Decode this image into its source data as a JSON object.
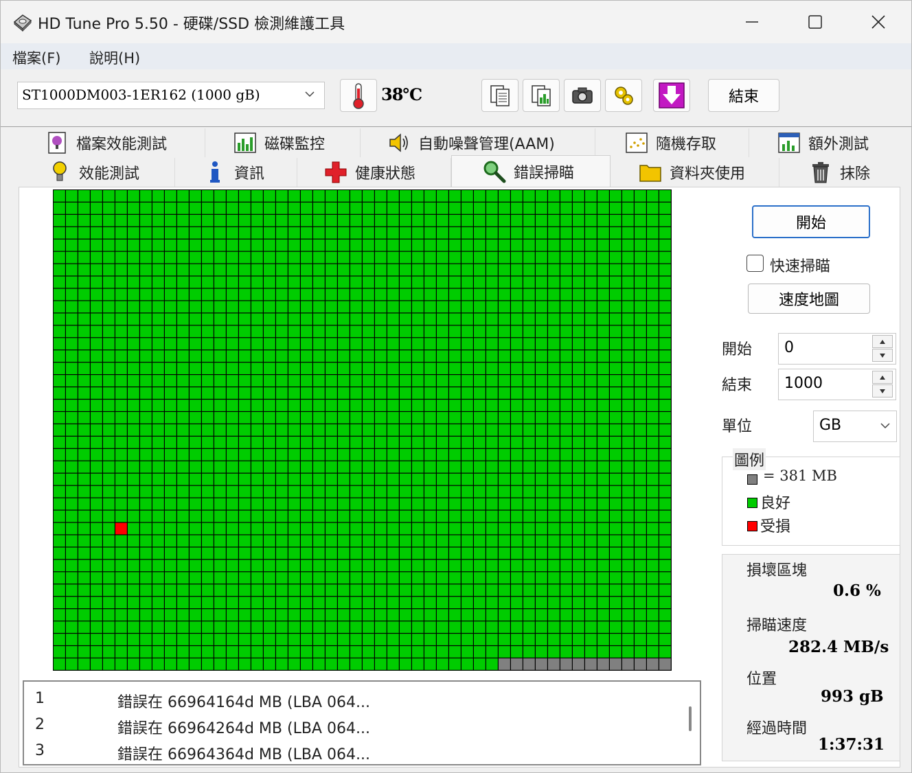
{
  "window": {
    "title": "HD Tune Pro 5.50 - 硬碟/SSD 檢測維護工具"
  },
  "menu": {
    "file": "檔案(F)",
    "help": "說明(H)"
  },
  "toolbar": {
    "drive": "ST1000DM003-1ER162 (1000 gB)",
    "temperature": "38℃",
    "exit_label": "結束",
    "icons": [
      "copy-text-icon",
      "copy-image-icon",
      "screenshot-icon",
      "options-icon",
      "save-icon"
    ]
  },
  "tabs": {
    "row1": [
      "檔案效能測試",
      "磁碟監控",
      "自動噪聲管理(AAM)",
      "隨機存取",
      "額外測試"
    ],
    "row2": [
      "效能測試",
      "資訊",
      "健康狀態",
      "錯誤掃瞄",
      "資料夾使用",
      "抹除"
    ],
    "active": "錯誤掃瞄"
  },
  "controls": {
    "start_button": "開始",
    "quick_scan_label": "快速掃瞄",
    "quick_scan_checked": false,
    "speed_map_button": "速度地圖",
    "start_label": "開始",
    "start_value": "0",
    "end_label": "結束",
    "end_value": "1000",
    "unit_label": "單位",
    "unit_value": "GB"
  },
  "legend": {
    "title": "圖例",
    "block_size": "= 381 MB",
    "good": "良好",
    "damaged": "受損"
  },
  "stats": {
    "damaged_blocks_label": "損壞區塊",
    "damaged_blocks_value": "0.6 %",
    "scan_speed_label": "掃瞄速度",
    "scan_speed_value": "282.4 MB/s",
    "position_label": "位置",
    "position_value": "993 gB",
    "elapsed_label": "經過時間",
    "elapsed_value": "1:37:31"
  },
  "grid": {
    "cols": 50,
    "rows": 39,
    "damaged_cells": [
      [
        5,
        27
      ]
    ],
    "unscanned_from_index_last_row": 36,
    "colors": {
      "good": "#00cc00",
      "damaged": "#ff0000",
      "unscanned": "#808080",
      "border": "#000000"
    }
  },
  "errors": [
    {
      "index": "1",
      "message": "錯誤在 66964164d MB (LBA 064..."
    },
    {
      "index": "2",
      "message": "錯誤在 66964264d MB (LBA 064..."
    },
    {
      "index": "3",
      "message": "錯誤在 66964364d MB (LBA 064..."
    }
  ]
}
